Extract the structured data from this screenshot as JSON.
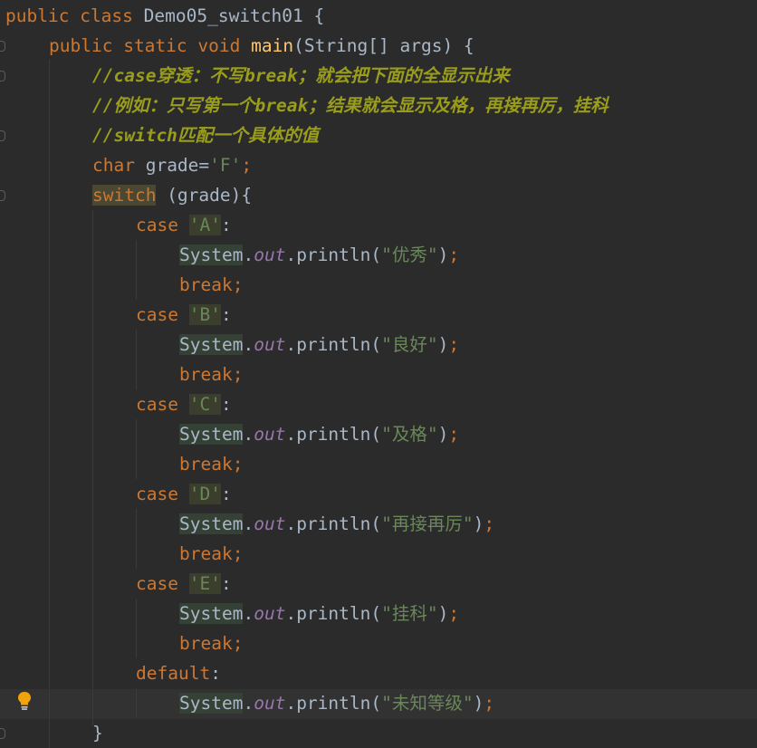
{
  "code": {
    "class_line": {
      "kw1": "public",
      "kw2": "class",
      "name": "Demo05_switch01",
      "brace": "{"
    },
    "main_line": {
      "kw1": "public",
      "kw2": "static",
      "kw3": "void",
      "method": "main",
      "params": "(String[] args) {"
    },
    "comment1": {
      "slashes": "//",
      "kw": "case",
      "text1": "穿透：不写",
      "kw2": "break",
      "text2": "；就会把下面的全显示出来"
    },
    "comment2": {
      "slashes": "//",
      "text1": "例如：只写第一个",
      "kw": "break",
      "text2": "；结果就会显示及格，再接再厉，挂科"
    },
    "comment3": {
      "slashes": "//",
      "kw": "switch",
      "text1": "匹配一个具体的值"
    },
    "char_line": {
      "kw": "char",
      "rest": " grade=",
      "val": "'F'",
      "semi": ";"
    },
    "switch_line": {
      "kw": "switch",
      "rest": " (grade){"
    },
    "cases": [
      {
        "case_kw": "case",
        "val": "'A'",
        "colon": ":",
        "out": "优秀",
        "break_kw": "break",
        "semi": ";"
      },
      {
        "case_kw": "case",
        "val": "'B'",
        "colon": ":",
        "out": "良好",
        "break_kw": "break",
        "semi": ";"
      },
      {
        "case_kw": "case",
        "val": "'C'",
        "colon": ":",
        "out": "及格",
        "break_kw": "break",
        "semi": ";"
      },
      {
        "case_kw": "case",
        "val": "'D'",
        "colon": ":",
        "out": "再接再厉",
        "break_kw": "break",
        "semi": ";"
      },
      {
        "case_kw": "case",
        "val": "'E'",
        "colon": ":",
        "out": "挂科",
        "break_kw": "break",
        "semi": ";"
      }
    ],
    "default_line": {
      "kw": "default",
      "colon": ":",
      "out": "未知等级"
    },
    "close_brace": "}",
    "print": {
      "cls": "System",
      "dot1": ".",
      "field": "out",
      "dot2": ".",
      "method": "println",
      "open": "(",
      "quote": "\"",
      "close": ")"
    }
  },
  "colors": {
    "background": "#2b2b2b",
    "keyword": "#cc7832",
    "string": "#6a8759",
    "comment": "#999d1b",
    "method": "#ffc66d",
    "field": "#9876aa",
    "text": "#a9b7c6"
  },
  "icons": [
    "fold-marker-icon",
    "lightbulb-icon"
  ]
}
